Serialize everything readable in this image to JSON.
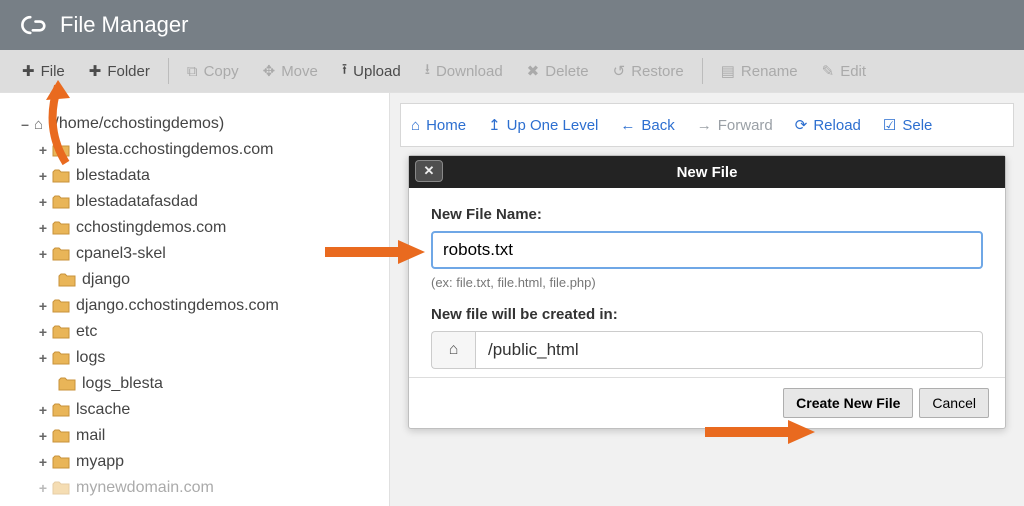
{
  "header": {
    "title": "File Manager"
  },
  "toolbar": {
    "file": "File",
    "folder": "Folder",
    "copy": "Copy",
    "move": "Move",
    "upload": "Upload",
    "download": "Download",
    "delete": "Delete",
    "restore": "Restore",
    "rename": "Rename",
    "edit": "Edit"
  },
  "nav": {
    "home": "Home",
    "up": "Up One Level",
    "back": "Back",
    "forward": "Forward",
    "reload": "Reload",
    "select": "Sele"
  },
  "tree": {
    "root": "(/home/cchostingdemos)",
    "items": [
      "blesta.cchostingdemos.com",
      "blestadata",
      "blestadatafasdad",
      "cchostingdemos.com",
      "cpanel3-skel",
      "django",
      "django.cchostingdemos.com",
      "etc",
      "logs",
      "logs_blesta",
      "lscache",
      "mail",
      "myapp",
      "mynewdomain.com"
    ]
  },
  "dialog": {
    "title": "New File",
    "name_label": "New File Name:",
    "name_value": "robots.txt",
    "hint": "(ex: file.txt, file.html, file.php)",
    "path_label": "New file will be created in:",
    "path_value": "/public_html",
    "create": "Create New File",
    "cancel": "Cancel"
  }
}
